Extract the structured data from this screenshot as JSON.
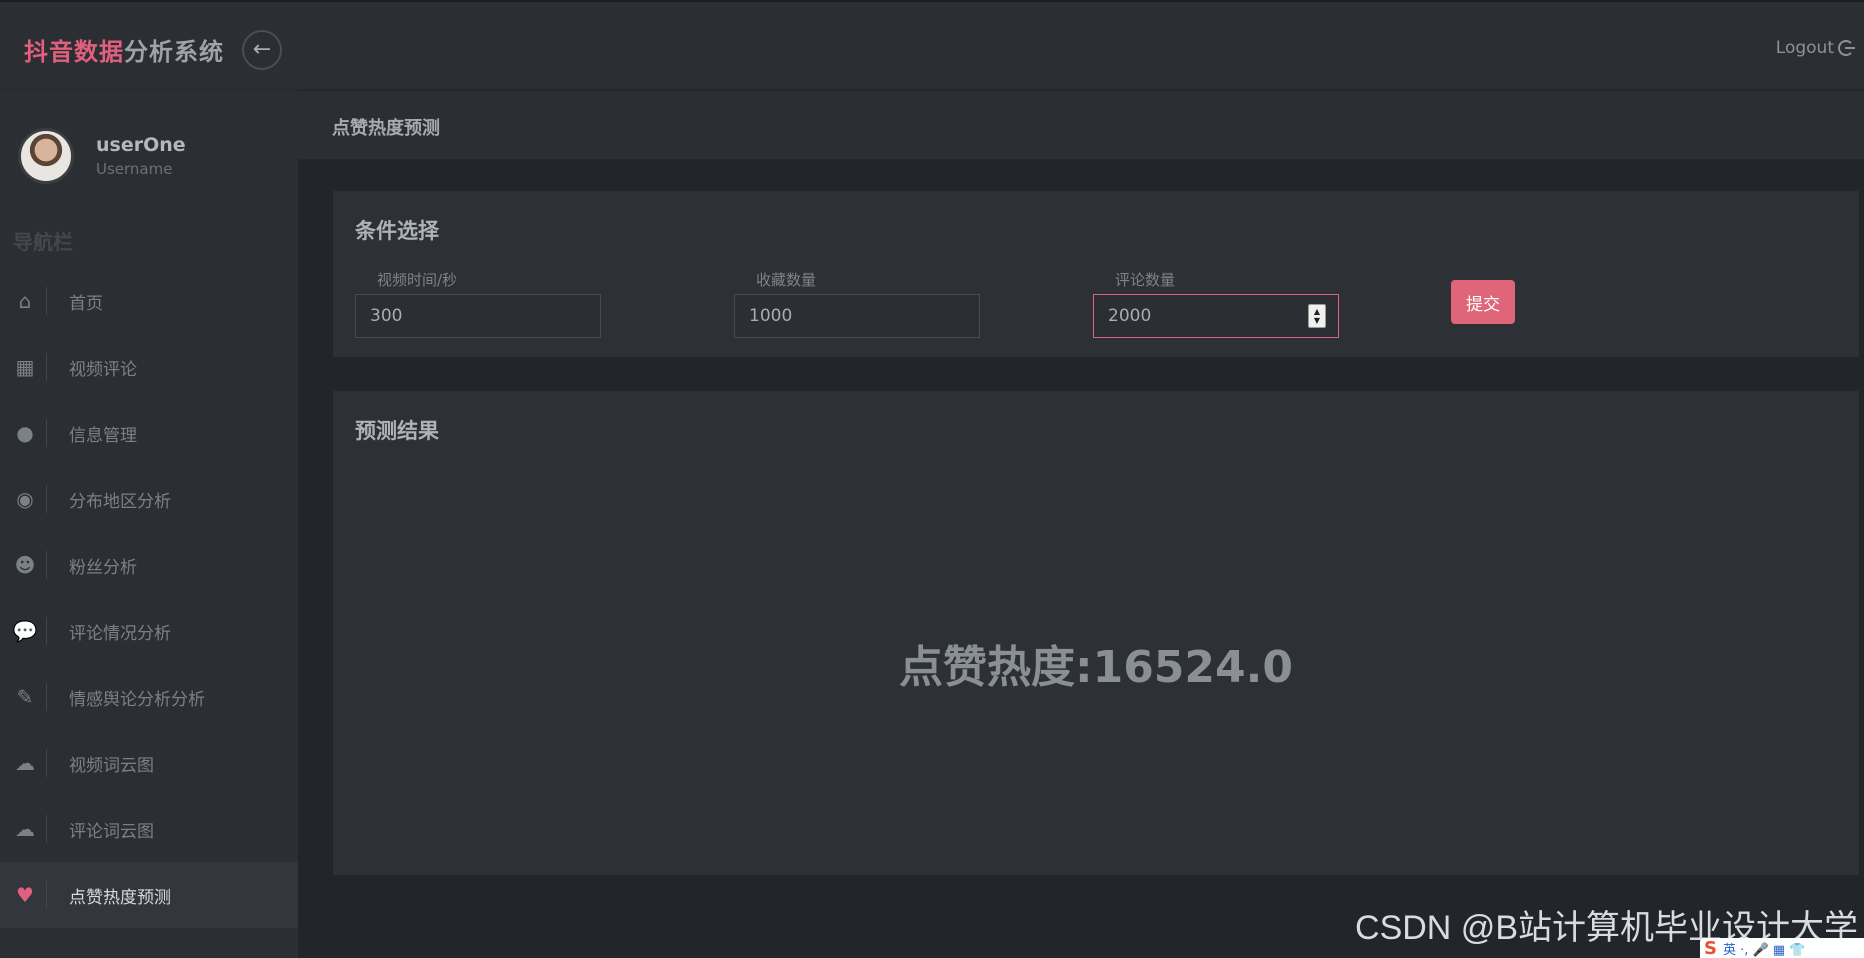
{
  "header": {
    "brand_accent": "抖音数据",
    "brand_rest": "分析系统",
    "back_icon": "←",
    "logout_label": "Logout"
  },
  "user": {
    "name": "userOne",
    "role": "Username"
  },
  "sidebar": {
    "title": "导航栏",
    "items": [
      {
        "icon": "⌂",
        "label": "首页"
      },
      {
        "icon": "▦",
        "label": "视频评论"
      },
      {
        "icon": "●",
        "label": "信息管理"
      },
      {
        "icon": "◉",
        "label": "分布地区分析"
      },
      {
        "icon": "☻",
        "label": "粉丝分析"
      },
      {
        "icon": "💬",
        "label": "评论情况分析"
      },
      {
        "icon": "✎",
        "label": "情感舆论分析分析"
      },
      {
        "icon": "☁",
        "label": "视频词云图"
      },
      {
        "icon": "☁",
        "label": "评论词云图"
      },
      {
        "icon": "♥",
        "label": "点赞热度预测"
      }
    ]
  },
  "page": {
    "title": "点赞热度预测"
  },
  "filter": {
    "title": "条件选择",
    "fields": [
      {
        "label": "视频时间/秒",
        "value": "300"
      },
      {
        "label": "收藏数量",
        "value": "1000"
      },
      {
        "label": "评论数量",
        "value": "2000"
      }
    ],
    "submit_label": "提交"
  },
  "result": {
    "title": "预测结果",
    "value": "点赞热度:16524.0"
  },
  "watermark": "CSDN @B站计算机毕业设计大学",
  "ime": {
    "logo": "S",
    "label": "英 ·, 🎤 ▦ 👕"
  }
}
